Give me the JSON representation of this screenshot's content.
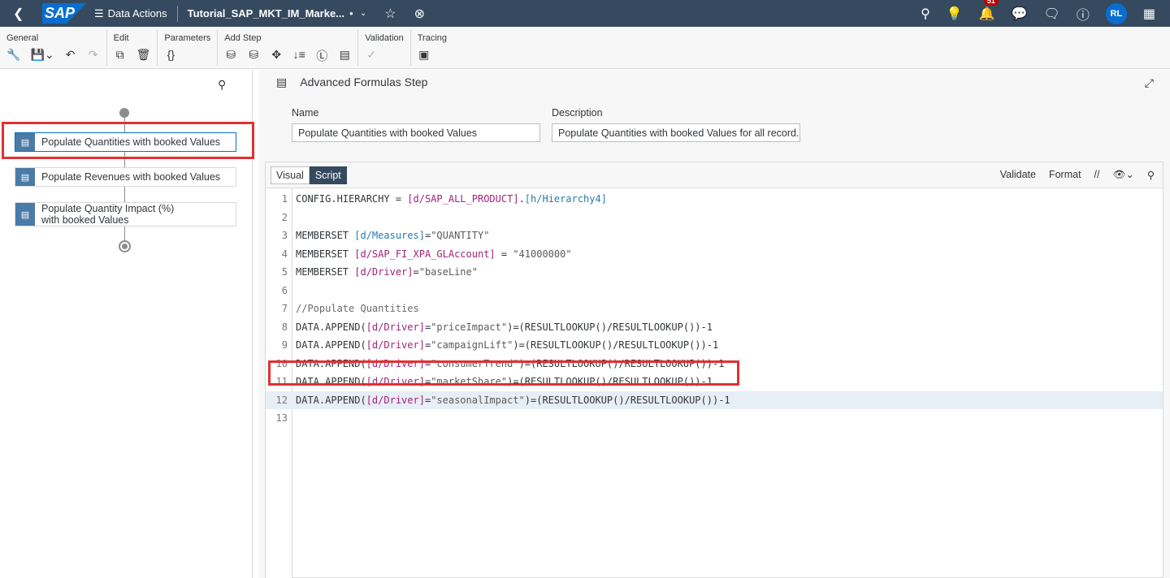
{
  "shell": {
    "app_name": "Data Actions",
    "doc_title": "Tutorial_SAP_MKT_IM_Marke...",
    "notif_count": "51",
    "avatar": "RL"
  },
  "toolbar": {
    "general": "General",
    "edit": "Edit",
    "parameters": "Parameters",
    "add_step": "Add Step",
    "validation": "Validation",
    "tracing": "Tracing",
    "parameters_icon": "{}"
  },
  "steps": [
    {
      "label": "Populate Quantities with booked Values"
    },
    {
      "label": "Populate Revenues with booked Values"
    },
    {
      "label": "Populate Quantity Impact (%) with booked Values"
    }
  ],
  "panel": {
    "title": "Advanced Formulas Step",
    "name_label": "Name",
    "name_value": "Populate Quantities with booked Values",
    "desc_label": "Description",
    "desc_value": "Populate Quantities with booked Values for all record..."
  },
  "editor": {
    "tab_visual": "Visual",
    "tab_script": "Script",
    "validate": "Validate",
    "format": "Format",
    "comment": "//"
  },
  "code": [
    {
      "n": "1",
      "parts": [
        [
          "",
          "CONFIG.HIERARCHY = "
        ],
        [
          "k",
          "[d/SAP_ALL_PRODUCT]"
        ],
        [
          "",
          "."
        ],
        [
          "b",
          "[h/Hierarchy4]"
        ]
      ]
    },
    {
      "n": "2",
      "parts": []
    },
    {
      "n": "3",
      "parts": [
        [
          "",
          "MEMBERSET "
        ],
        [
          "b",
          "[d/Measures]"
        ],
        [
          "",
          "="
        ],
        [
          "s",
          "\"QUANTITY\""
        ]
      ]
    },
    {
      "n": "4",
      "parts": [
        [
          "",
          "MEMBERSET "
        ],
        [
          "k",
          "[d/SAP_FI_XPA_GLAccount]"
        ],
        [
          "",
          " = "
        ],
        [
          "s",
          "\"41000000\""
        ]
      ]
    },
    {
      "n": "5",
      "parts": [
        [
          "",
          "MEMBERSET "
        ],
        [
          "k",
          "[d/Driver]"
        ],
        [
          "",
          "="
        ],
        [
          "s",
          "\"baseLine\""
        ]
      ]
    },
    {
      "n": "6",
      "parts": []
    },
    {
      "n": "7",
      "parts": [
        [
          "c",
          "//Populate Quantities"
        ]
      ]
    },
    {
      "n": "8",
      "parts": [
        [
          "",
          "DATA.APPEND("
        ],
        [
          "k",
          "[d/Driver]"
        ],
        [
          "",
          "="
        ],
        [
          "s",
          "\"priceImpact\""
        ],
        [
          "",
          ")=(RESULTLOOKUP()/RESULTLOOKUP())-1"
        ]
      ]
    },
    {
      "n": "9",
      "parts": [
        [
          "",
          "DATA.APPEND("
        ],
        [
          "k",
          "[d/Driver]"
        ],
        [
          "",
          "="
        ],
        [
          "s",
          "\"campaignLift\""
        ],
        [
          "",
          ")=(RESULTLOOKUP()/RESULTLOOKUP())-1"
        ]
      ]
    },
    {
      "n": "10",
      "parts": [
        [
          "",
          "DATA.APPEND("
        ],
        [
          "k",
          "[d/Driver]"
        ],
        [
          "",
          "="
        ],
        [
          "s",
          "\"consumerTrend\""
        ],
        [
          "",
          ")=(RESULTLOOKUP()/RESULTLOOKUP())-1"
        ]
      ]
    },
    {
      "n": "11",
      "parts": [
        [
          "",
          "DATA.APPEND("
        ],
        [
          "k",
          "[d/Driver]"
        ],
        [
          "",
          "="
        ],
        [
          "s",
          "\"marketShare\""
        ],
        [
          "",
          ")=(RESULTLOOKUP()/RESULTLOOKUP())-1"
        ]
      ]
    },
    {
      "n": "12",
      "parts": [
        [
          "",
          "DATA.APPEND("
        ],
        [
          "k",
          "[d/Driver]"
        ],
        [
          "",
          "="
        ],
        [
          "s",
          "\"seasonalImpact\""
        ],
        [
          "",
          ")=(RESULTLOOKUP()/RESULTLOOKUP())-1"
        ]
      ]
    },
    {
      "n": "13",
      "parts": []
    }
  ],
  "icons": {
    "back": "chevron-left-icon",
    "search": "search-icon",
    "bell": "bell-icon",
    "star": "star-icon",
    "close": "close-circle-icon"
  }
}
